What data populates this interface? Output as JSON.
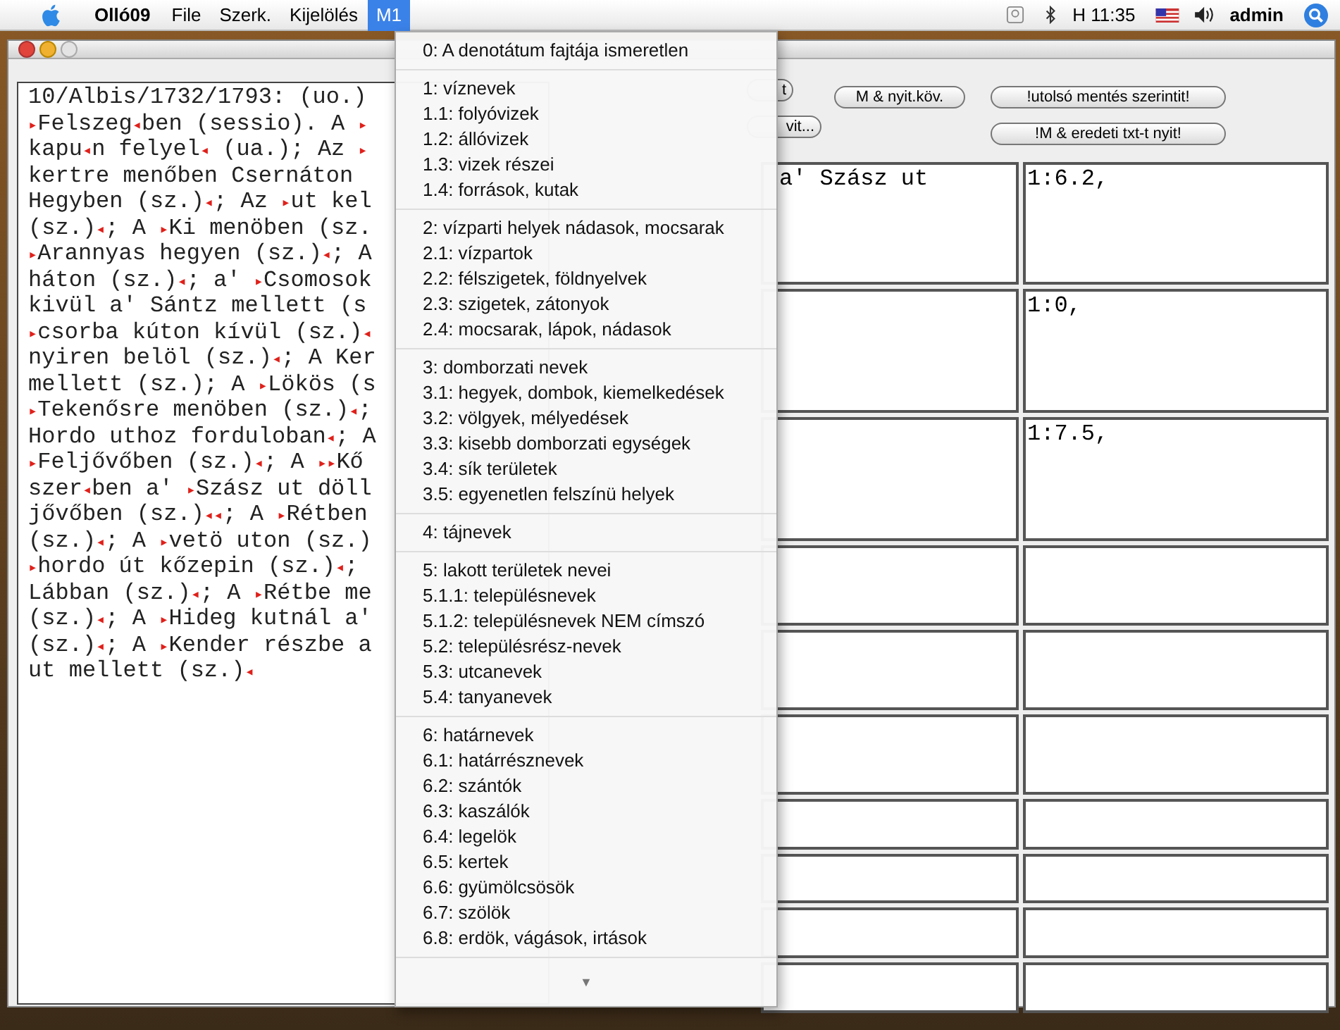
{
  "menu_bar": {
    "app_name": "Olló09",
    "menus": [
      {
        "label": "File",
        "selected": false
      },
      {
        "label": "Szerk.",
        "selected": false
      },
      {
        "label": "Kijelölés",
        "selected": false
      },
      {
        "label": "M1",
        "selected": true
      }
    ],
    "clock": "H 11:35",
    "user": "admin"
  },
  "dropdown": {
    "groups": [
      [
        "0: A denotátum fajtája ismeretlen"
      ],
      [
        "1: víznevek",
        "1.1: folyóvizek",
        "1.2: állóvizek",
        "1.3: vizek részei",
        "1.4: források, kutak"
      ],
      [
        "2: vízparti helyek nádasok, mocsarak",
        "2.1: vízpartok",
        "2.2: félszigetek, földnyelvek",
        "2.3: szigetek, zátonyok",
        "2.4: mocsarak, lápok, nádasok"
      ],
      [
        "3: domborzati nevek",
        "3.1: hegyek, dombok, kiemelkedések",
        "3.2: völgyek, mélyedések",
        "3.3: kisebb domborzati egységek",
        "3.4: sík területek",
        "3.5: egyenetlen felszínü helyek"
      ],
      [
        "4: tájnevek"
      ],
      [
        "5: lakott területek nevei",
        "5.1.1: településnevek",
        "5.1.2: településnevek NEM címszó",
        "5.2: településrész-nevek",
        "5.3: utcanevek",
        "5.4: tanyanevek"
      ],
      [
        "6: határnevek",
        "6.1: határrésznevek",
        "6.2: szántók",
        "6.3: kaszálók",
        "6.4: legelök",
        "6.5: kertek",
        "6.6: gyümölcsösök",
        "6.7: szölök",
        "6.8: erdök, vágások, irtások"
      ]
    ],
    "scroll_hint": "▼"
  },
  "editor": {
    "lines": [
      "10/Albis/1732/1793: (uo.)",
      "▸Felszeg◂ben (sessio). A ▸",
      "kapu◂n felyel◂ (ua.); Az ▸",
      "kertre menőben Csernáton",
      "Hegyben (sz.)◂; Az ▸ut kel",
      "(sz.)◂; A ▸Ki menöben (sz.",
      "▸Arannyas hegyen (sz.)◂; A",
      "háton (sz.)◂; a' ▸Csomosok",
      "kivül a' Sántz mellett (s",
      "▸csorba kúton kívül (sz.)◂",
      "nyiren belöl (sz.)◂; A Ker",
      "mellett (sz.); A ▸Lökös (s",
      "▸Tekenősre menöben (sz.)◂;",
      "Hordo uthoz forduloban◂; A",
      "▸Feljővőben (sz.)◂; A ▸▸Kő",
      "szer◂ben a' ▸Szász ut döll",
      "jővőben (sz.)◂◂; A ▸Rétben",
      "(sz.)◂; A ▸vetö uton (sz.)",
      "▸hordo út kőzepin (sz.)◂;",
      "Lábban (sz.)◂; A ▸Rétbe me",
      "(sz.)◂; A ▸Hideg kutnál a'",
      "(sz.)◂; A ▸Kender részbe a",
      "ut mellett (sz.)◂"
    ]
  },
  "buttons": {
    "row_1": [
      "t",
      "M & nyit.köv.",
      "!utolsó mentés szerintit!"
    ],
    "row_2": [
      "vit...",
      "!M & eredeti txt-t nyit!"
    ]
  },
  "table": {
    "rows": [
      {
        "column_1": "a' Szász ut",
        "column_2": "1:6.2,"
      },
      {
        "column_2": "1:0,"
      },
      {
        "column_2": "1:7.5,"
      },
      {},
      {},
      {},
      {},
      {},
      {},
      {}
    ]
  }
}
